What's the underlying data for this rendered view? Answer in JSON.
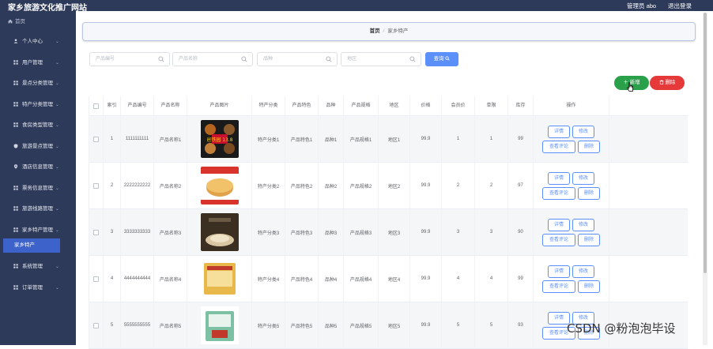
{
  "header": {
    "site_title": "家乡旅游文化推广网站",
    "admin_label": "管理员 abo",
    "logout_label": "退出登录"
  },
  "sidebar": {
    "home_label": "首页",
    "items": [
      {
        "label": "个人中心",
        "icon": "person-icon"
      },
      {
        "label": "用户管理",
        "icon": "grid-icon"
      },
      {
        "label": "景点分类管理",
        "icon": "grid-icon"
      },
      {
        "label": "特产分类管理",
        "icon": "grid-icon"
      },
      {
        "label": "食房类型管理",
        "icon": "grid-icon"
      },
      {
        "label": "旅游景点管理",
        "icon": "shield-icon"
      },
      {
        "label": "酒店信息管理",
        "icon": "pin-icon"
      },
      {
        "label": "票务信息管理",
        "icon": "grid-icon"
      },
      {
        "label": "旅游线路管理",
        "icon": "grid-icon"
      },
      {
        "label": "家乡特产管理",
        "icon": "grid-icon"
      },
      {
        "label": "系统管理",
        "icon": "grid-icon"
      },
      {
        "label": "订单管理",
        "icon": "grid-icon"
      }
    ],
    "active_sub": "家乡特产"
  },
  "breadcrumb": {
    "home": "首页",
    "separator": "/",
    "current": "家乡特产"
  },
  "search": {
    "placeholders": [
      "产品编号",
      "产品名称",
      "品种",
      "地区"
    ],
    "query_label": "查询"
  },
  "actions": {
    "add_label": "新增",
    "delete_label": "删除"
  },
  "table": {
    "headers": [
      "索引",
      "产品编号",
      "产品名称",
      "产品图片",
      "特产分类",
      "产品特色",
      "品种",
      "产品规格",
      "地区",
      "价格",
      "会员价",
      "单限",
      "库存",
      "操作"
    ],
    "op_labels": {
      "detail": "详情",
      "edit": "修改",
      "review": "查看评论",
      "delete": "删除"
    },
    "rows": [
      {
        "index": "1",
        "code": "1111111111",
        "name": "产品名称1",
        "image_caption": "岜铁园 13.8",
        "category": "特产分类1",
        "feature": "产品特色1",
        "variety": "品种1",
        "spec": "产品规格1",
        "region": "地区1",
        "price": "99.9",
        "member_price": "1",
        "limit": "1",
        "stock": "99"
      },
      {
        "index": "2",
        "code": "2222222222",
        "name": "产品名称2",
        "image_caption": "",
        "category": "特产分类2",
        "feature": "产品特色2",
        "variety": "品种2",
        "spec": "产品规格2",
        "region": "地区2",
        "price": "99.9",
        "member_price": "2",
        "limit": "2",
        "stock": "97"
      },
      {
        "index": "3",
        "code": "3333333333",
        "name": "产品名称3",
        "image_caption": "",
        "category": "特产分类3",
        "feature": "产品特色3",
        "variety": "品种3",
        "spec": "产品规格3",
        "region": "地区3",
        "price": "99.9",
        "member_price": "3",
        "limit": "3",
        "stock": "90"
      },
      {
        "index": "4",
        "code": "4444444444",
        "name": "产品名称4",
        "image_caption": "",
        "category": "特产分类4",
        "feature": "产品特色4",
        "variety": "品种4",
        "spec": "产品规格4",
        "region": "地区4",
        "price": "99.9",
        "member_price": "4",
        "limit": "4",
        "stock": "99"
      },
      {
        "index": "5",
        "code": "5555555555",
        "name": "产品名称5",
        "image_caption": "",
        "category": "特产分类5",
        "feature": "产品特色5",
        "variety": "品种5",
        "spec": "产品规格5",
        "region": "地区5",
        "price": "99.9",
        "member_price": "5",
        "limit": "5",
        "stock": "93"
      }
    ]
  },
  "watermark": "CSDN @粉泡泡毕设",
  "colors": {
    "sidebar_bg": "#2e3a59",
    "accent": "#5b8ff9",
    "add_green": "#2ba04b",
    "delete_red": "#e6393a",
    "active_sub_bg": "#3d62c9"
  }
}
